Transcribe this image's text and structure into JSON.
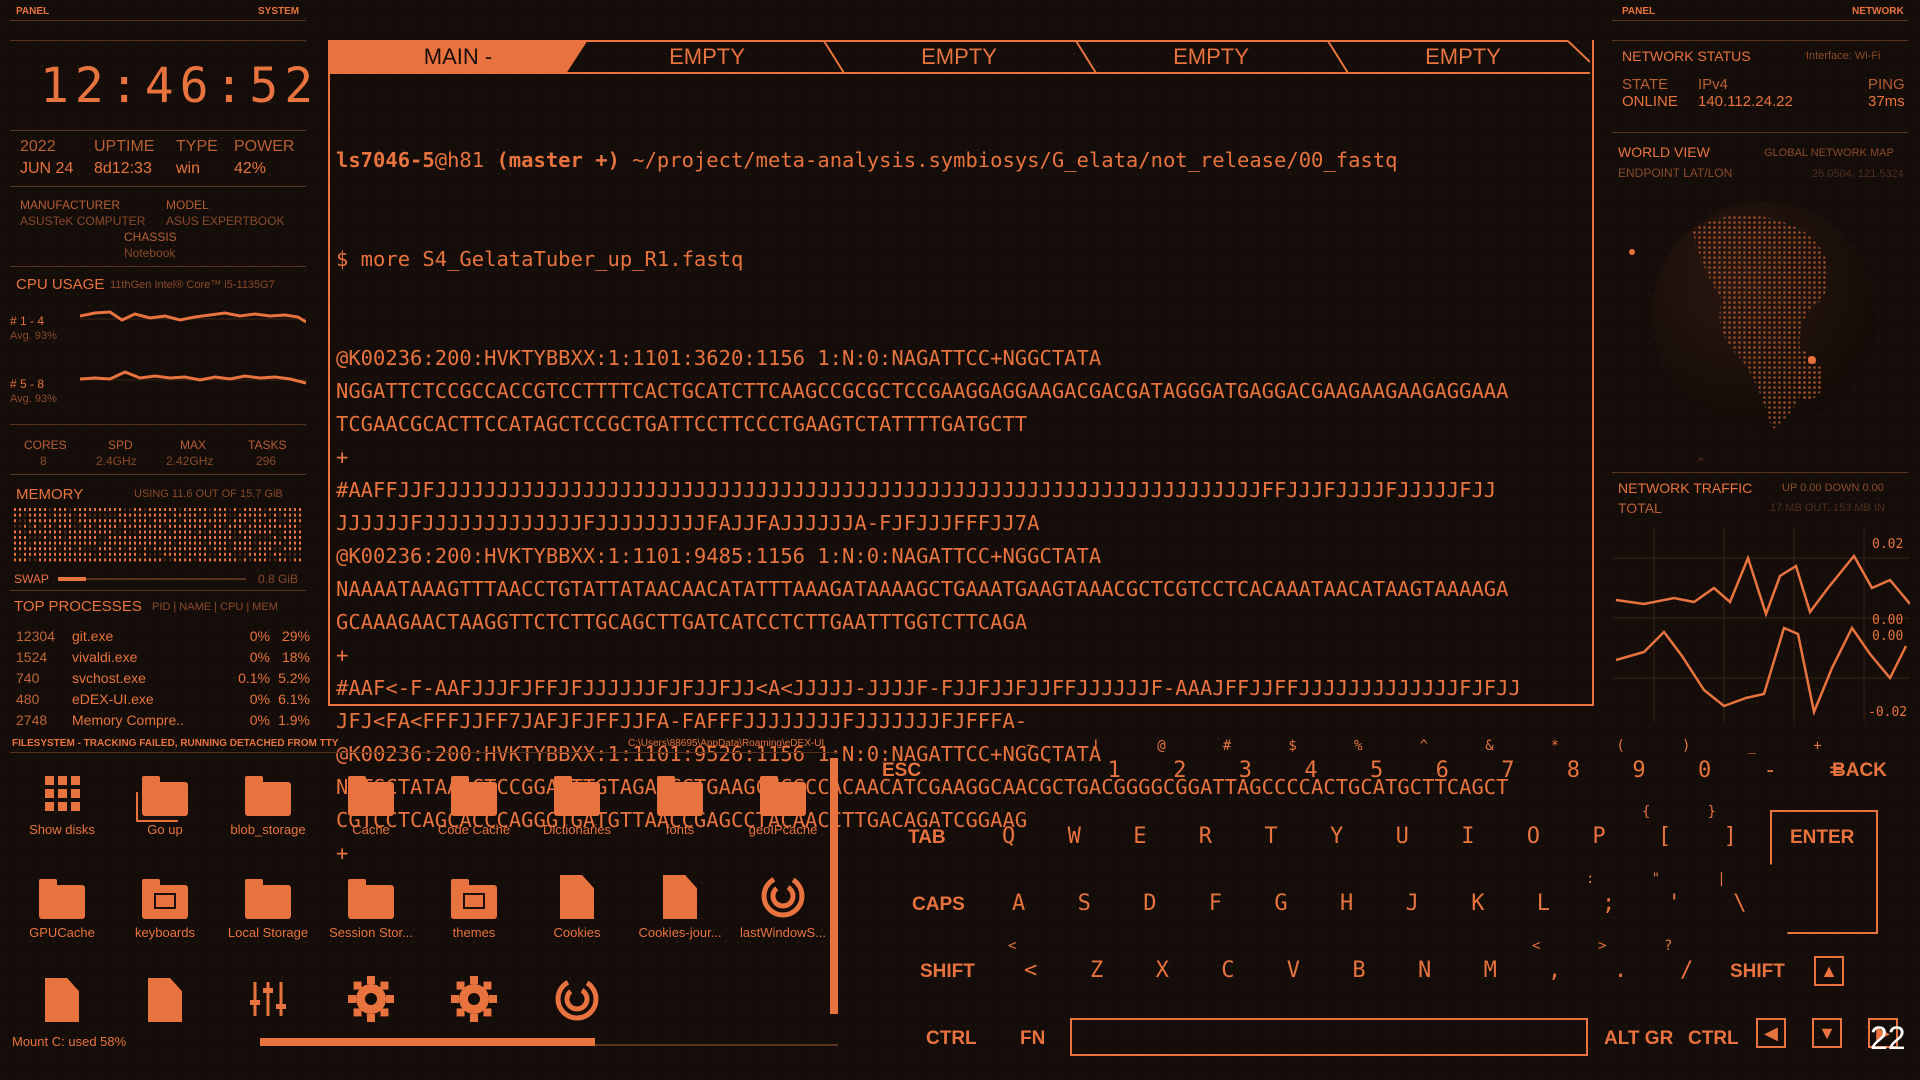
{
  "left": {
    "panel_label": "PANEL",
    "system_label": "SYSTEM",
    "clock": "12:46:52",
    "stats": [
      {
        "label": "2022",
        "value": "JUN 24"
      },
      {
        "label": "UPTIME",
        "value": "8d12:33"
      },
      {
        "label": "TYPE",
        "value": "win"
      },
      {
        "label": "POWER",
        "value": "42%"
      }
    ],
    "manufacturer_label": "MANUFACTURER",
    "manufacturer": "ASUSTeK COMPUTER",
    "model_label": "MODEL",
    "model": "ASUS EXPERTBOOK",
    "chassis_label": "CHASSIS",
    "chassis": "Notebook",
    "cpu_label": "CPU USAGE",
    "cpu_model": "11thGen Intel® Core™ i5-1135G7",
    "cpu_groups": [
      {
        "label": "# 1 - 4",
        "avg": "Avg. 93%"
      },
      {
        "label": "# 5 - 8",
        "avg": "Avg. 93%"
      }
    ],
    "cpu_stats": [
      {
        "label": "CORES",
        "value": "8"
      },
      {
        "label": "SPD",
        "value": "2.4GHz"
      },
      {
        "label": "MAX",
        "value": "2.42GHz"
      },
      {
        "label": "TASKS",
        "value": "296"
      }
    ],
    "memory_label": "MEMORY",
    "memory_usage": "USING 11.6 OUT OF 15.7 GiB",
    "swap_label": "SWAP",
    "swap_value": "0.8 GiB",
    "swap_fraction": 0.15,
    "processes_label": "TOP PROCESSES",
    "processes_cols": "PID | NAME | CPU | MEM",
    "processes": [
      {
        "pid": "12304",
        "name": "git.exe",
        "cpu": "0%",
        "mem": "29%"
      },
      {
        "pid": "1524",
        "name": "vivaldi.exe",
        "cpu": "0%",
        "mem": "18%"
      },
      {
        "pid": "740",
        "name": "svchost.exe",
        "cpu": "0.1%",
        "mem": "5.2%"
      },
      {
        "pid": "480",
        "name": "eDEX-UI.exe",
        "cpu": "0%",
        "mem": "6.1%"
      },
      {
        "pid": "2748",
        "name": "Memory Compre..",
        "cpu": "0%",
        "mem": "1.9%"
      }
    ]
  },
  "terminal": {
    "tabs": [
      "MAIN -",
      "EMPTY",
      "EMPTY",
      "EMPTY",
      "EMPTY"
    ],
    "prompt_user": "ls7046-5",
    "prompt_host": "@h81",
    "prompt_branch": "(master +)",
    "prompt_path": " ~/project/meta-analysis.symbiosys/G_elata/not_release/00_fastq",
    "command": "$ more S4_GelataTuber_up_R1.fastq",
    "lines": [
      "@K00236:200:HVKTYBBXX:1:1101:3620:1156 1:N:0:NAGATTCC+NGGCTATA",
      "NGGATTCTCCGCCACCGTCCTTTTCACTGCATCTTCAAGCCGCGCTCCGAAGGAGGAAGACGACGATAGGGATGAGGACGAAGAAGAAGAGGAAA",
      "TCGAACGCACTTCCATAGCTCCGCTGATTCCTTCCCTGAAGTCTATTTTGATGCTT",
      "+",
      "#AAFFJJFJJJJJJJJJJJJJJJJJJJJJJJJJJJJJJJJJJJJJJJJJJJJJJJJJJJJJJJJJJJJJJJJJJJFFJJJFJJJJFJJJJJFJJ",
      "JJJJJJFJJJJJJJJJJJJJFJJJJJJJJJFAJJFAJJJJJJA-FJFJJJFFFJJ7A",
      "@K00236:200:HVKTYBBXX:1:1101:9485:1156 1:N:0:NAGATTCC+NGGCTATA",
      "NAAAATAAAGTTTAACCTGTATTATAACAACATATTTAAAGATAAAAGCTGAAATGAAGTAAACGCTCGTCCTCACAAATAACATAAGTAAAAGA",
      "GCAAAGAACTAAGGTTCTCTTGCAGCTTGATCATCCTCTTGAATTTGGTCTTCAGA",
      "+",
      "#AAF<-F-AAFJJJFJFFJFJJJJJJFJFJJFJJ<A<JJJJJ-JJJJF-FJJFJJFJJFFJJJJJJF-AAAJFFJJFFJJJJJJJJJJJJJFJFJJ",
      "JFJ<FA<FFFJJFF7JAFJFJFFJJFA-FAFFFJJJJJJJJFJJJJJJJFJFFFA-",
      "@K00236:200:HVKTYBBXX:1:1101:9526:1156 1:N:0:NAGATTCC+NGGCTATA",
      "NTTGCTATAAACTCCGGAGTTGTAGAACCTGAAGCCGGCCACAACATCGAAGGCAACGCTGACGGGGCGGATTAGCCCCACTGCATGCTTCAGCT",
      "CGTCCTCAGCACCCAGGGTGATGTTAACCGAGCCTACAACCTTGACAGATCGGAAG",
      "+"
    ]
  },
  "right": {
    "panel_label": "PANEL",
    "network_label": "NETWORK",
    "status_title": "NETWORK STATUS",
    "interface": "Interface: Wi-Fi",
    "state_label": "STATE",
    "state": "ONLINE",
    "ipv4_label": "IPv4",
    "ipv4": "140.112.24.22",
    "ping_label": "PING",
    "ping": "37ms",
    "world_title": "WORLD VIEW",
    "world_sub": "GLOBAL NETWORK MAP",
    "endpoint_label": "ENDPOINT LAT/LON",
    "endpoint": "25.0504, 121.5324",
    "traffic_title": "NETWORK TRAFFIC",
    "traffic_rate": "UP 0.00 DOWN 0.00",
    "total_label": "TOTAL",
    "total": "17 MB OUT, 153 MB IN",
    "axis_top": [
      "0.02",
      "0.00"
    ],
    "axis_bottom": [
      "0.00",
      "-0.02"
    ]
  },
  "filesystem": {
    "title": "FILESYSTEM - TRACKING FAILED, RUNNING DETACHED FROM TTY",
    "path": "C:\\Users\\88695\\AppData\\Roaming\\eDEX-UI",
    "items": [
      {
        "label": "Show disks",
        "icon": "grid-icon"
      },
      {
        "label": "Go up",
        "icon": "folders-icon"
      },
      {
        "label": "blob_storage",
        "icon": "folder-icon"
      },
      {
        "label": "Cache",
        "icon": "folder-icon"
      },
      {
        "label": "Code Cache",
        "icon": "folder-icon"
      },
      {
        "label": "Dictionaries",
        "icon": "folder-icon"
      },
      {
        "label": "fonts",
        "icon": "folder-icon"
      },
      {
        "label": "geoIPcache",
        "icon": "folder-icon"
      },
      {
        "label": "GPUCache",
        "icon": "folder-icon"
      },
      {
        "label": "keyboards",
        "icon": "keyboard-folder-icon"
      },
      {
        "label": "Local Storage",
        "icon": "folder-icon"
      },
      {
        "label": "Session Stor...",
        "icon": "folder-icon"
      },
      {
        "label": "themes",
        "icon": "themes-folder-icon"
      },
      {
        "label": "Cookies",
        "icon": "file-icon"
      },
      {
        "label": "Cookies-jour...",
        "icon": "file-icon"
      },
      {
        "label": "lastWindowS...",
        "icon": "edex-icon"
      },
      {
        "label": "",
        "icon": "file-icon"
      },
      {
        "label": "",
        "icon": "file-icon"
      },
      {
        "label": "",
        "icon": "sliders-icon"
      },
      {
        "label": "",
        "icon": "gear-icon"
      },
      {
        "label": "",
        "icon": "gear-icon"
      },
      {
        "label": "",
        "icon": "edex-icon"
      }
    ],
    "mount_label": "Mount C: used",
    "mount_value": "58%",
    "mount_fraction": 0.58
  },
  "keyboard": {
    "row1": [
      [
        "~",
        "`"
      ],
      [
        "!",
        "1"
      ],
      [
        "@",
        "2"
      ],
      [
        "#",
        "3"
      ],
      [
        "$",
        "4"
      ],
      [
        "%",
        "5"
      ],
      [
        "^",
        "6"
      ],
      [
        "&",
        "7"
      ],
      [
        "*",
        "8"
      ],
      [
        "(",
        "9"
      ],
      [
        ")",
        "0"
      ],
      [
        "_",
        "-"
      ],
      [
        "+",
        "="
      ]
    ],
    "row2": [
      "Q",
      "W",
      "E",
      "R",
      "T",
      "Y",
      "U",
      "I",
      "O",
      "P"
    ],
    "row2b": [
      [
        "{",
        "["
      ],
      [
        "}",
        "]"
      ]
    ],
    "row3": [
      "A",
      "S",
      "D",
      "F",
      "G",
      "H",
      "J",
      "K",
      "L"
    ],
    "row3b": [
      [
        ":",
        ";"
      ],
      [
        "\"",
        "'"
      ],
      [
        "|",
        "\\"
      ]
    ],
    "row4": [
      "Z",
      "X",
      "C",
      "V",
      "B",
      "N",
      "M"
    ],
    "row4b": [
      [
        "<",
        ","
      ],
      [
        ">",
        "."
      ],
      [
        "?",
        "/"
      ]
    ],
    "labels": {
      "esc": "ESC",
      "back": "BACK",
      "tab": "TAB",
      "enter": "ENTER",
      "caps": "CAPS",
      "shift_l": "SHIFT",
      "shift_r": "SHIFT",
      "ctrl_l": "CTRL",
      "fn": "FN",
      "altgr": "ALT GR",
      "ctrl_r": "CTRL"
    }
  },
  "corner_number": "22"
}
